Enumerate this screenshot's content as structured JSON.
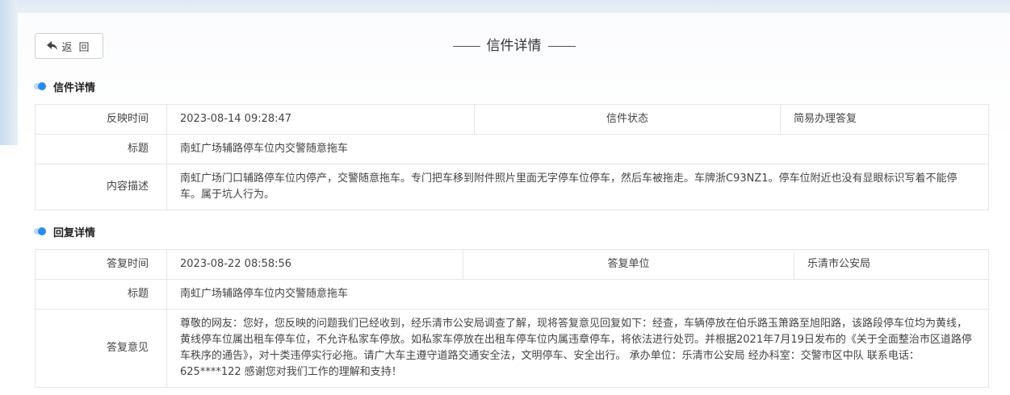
{
  "header": {
    "back_label": "返 回",
    "title": "信件详情"
  },
  "letter": {
    "section_title": "信件详情",
    "time_label": "反映时间",
    "time_value": "2023-08-14 09:28:47",
    "status_label": "信件状态",
    "status_value": "简易办理答复",
    "subject_label": "标题",
    "subject_value": "南虹广场辅路停车位内交警随意拖车",
    "content_label": "内容描述",
    "content_value": "南虹广场门口辅路停车位内停产，交警随意拖车。专门把车移到附件照片里面无字停车位停车，然后车被拖走。车牌浙C93NZ1。停车位附近也没有显眼标识写着不能停车。属于坑人行为。"
  },
  "reply": {
    "section_title": "回复详情",
    "time_label": "答复时间",
    "time_value": "2023-08-22 08:58:56",
    "unit_label": "答复单位",
    "unit_value": "乐清市公安局",
    "subject_label": "标题",
    "subject_value": "南虹广场辅路停车位内交警随意拖车",
    "opinion_label": "答复意见",
    "opinion_value": "尊敬的网友：您好，您反映的问题我们已经收到，经乐清市公安局调查了解，现将答复意见回复如下：经查，车辆停放在伯乐路玉箫路至旭阳路，该路段停车位均为黄线，黄线停车位属出租车停车位，不允许私家车停放。如私家车停放在出租车停车位内属违章停车，将依法进行处罚。并根据2021年7月19日发布的《关于全面整治市区道路停车秩序的通告》，对十类违停实行必拖。请广大车主遵守道路交通安全法，文明停车、安全出行。 承办单位：乐清市公安局 经办科室：交警市区中队 联系电话：625****122 感谢您对我们工作的理解和支持！"
  }
}
